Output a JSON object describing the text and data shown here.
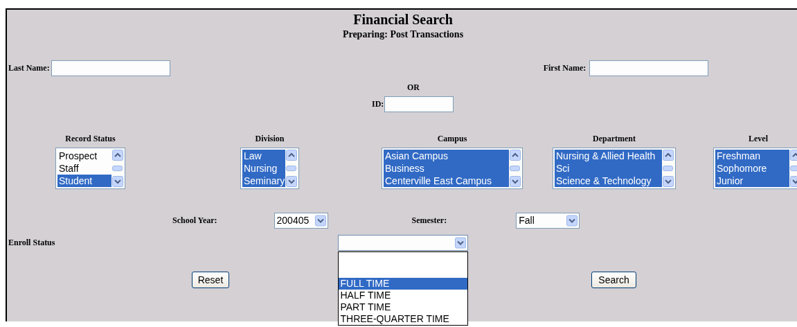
{
  "title": "Financial Search",
  "subtitle": "Preparing: Post Transactions",
  "last_name": {
    "label": "Last Name:"
  },
  "first_name": {
    "label": "First Name:"
  },
  "or_text": "OR",
  "id_field": {
    "label": "ID:"
  },
  "lists": [
    {
      "label": "Record Status",
      "options": [
        {
          "text": "Prospect",
          "selected": false
        },
        {
          "text": "Staff",
          "selected": false
        },
        {
          "text": "Student",
          "selected": true
        }
      ]
    },
    {
      "label": "Division",
      "options": [
        {
          "text": "Law",
          "selected": true
        },
        {
          "text": "Nursing",
          "selected": true
        },
        {
          "text": "Seminary",
          "selected": true
        }
      ]
    },
    {
      "label": "Campus",
      "options": [
        {
          "text": "Asian Campus",
          "selected": true
        },
        {
          "text": "Business",
          "selected": true
        },
        {
          "text": "Centerville East Campus",
          "selected": true
        }
      ]
    },
    {
      "label": "Department",
      "options": [
        {
          "text": "Nursing & Allied Health",
          "selected": true
        },
        {
          "text": "Sci",
          "selected": true
        },
        {
          "text": "Science & Technology",
          "selected": true
        }
      ]
    },
    {
      "label": "Level",
      "options": [
        {
          "text": "Freshman",
          "selected": true
        },
        {
          "text": "Sophomore",
          "selected": true
        },
        {
          "text": "Junior",
          "selected": true
        }
      ]
    }
  ],
  "school_year": {
    "label": "School Year:",
    "value": "200405"
  },
  "semester": {
    "label": "Semester:",
    "value": "Fall"
  },
  "enroll_status": {
    "label": "Enroll Status",
    "expanded": true,
    "options": [
      {
        "text": "FULL TIME",
        "selected": true
      },
      {
        "text": "HALF TIME",
        "selected": false
      },
      {
        "text": "PART TIME",
        "selected": false
      },
      {
        "text": "THREE-QUARTER TIME",
        "selected": false
      }
    ]
  },
  "buttons": [
    "Reset",
    "Search"
  ]
}
